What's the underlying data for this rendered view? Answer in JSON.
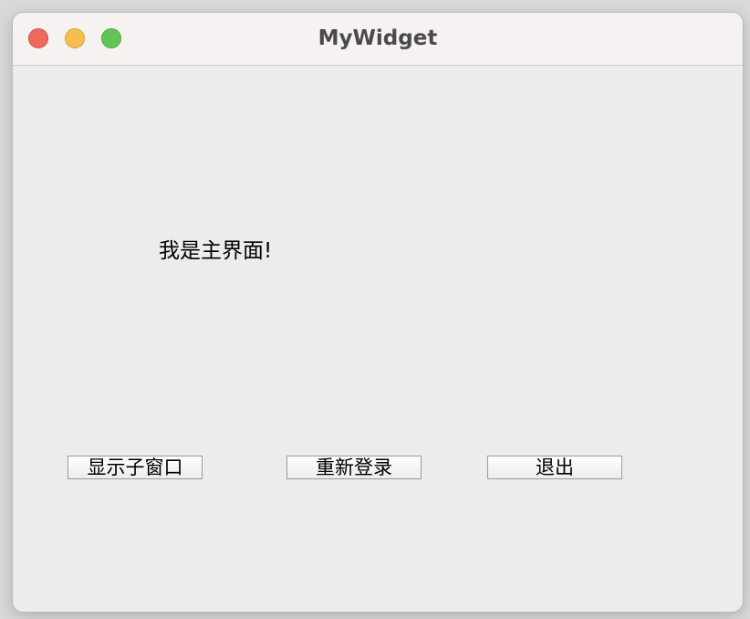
{
  "window": {
    "title": "MyWidget"
  },
  "main": {
    "label": "我是主界面!"
  },
  "buttons": {
    "show_child": "显示子窗口",
    "relogin": "重新登录",
    "exit": "退出"
  },
  "colors": {
    "close": "#ed6a5e",
    "minimize": "#f5bf4f",
    "maximize": "#61c554",
    "window_bg": "#ececec",
    "titlebar_bg": "#f6f2f2"
  }
}
